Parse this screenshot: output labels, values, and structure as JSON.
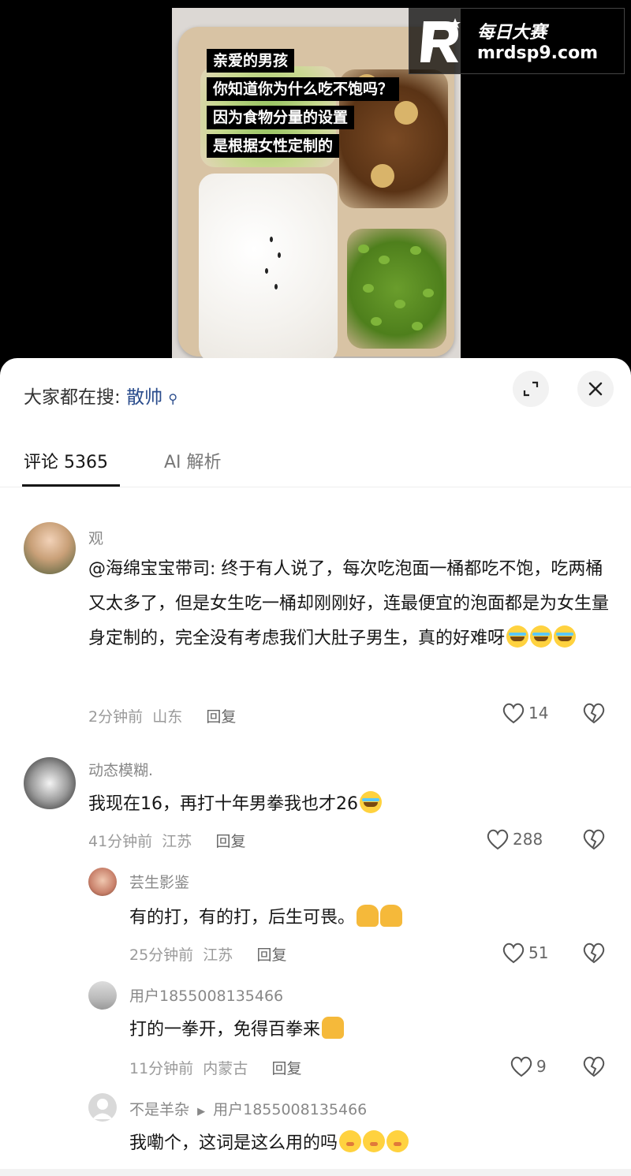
{
  "video": {
    "captions": [
      "亲爱的男孩",
      "你知道你为什么吃不饱吗？",
      "因为食物分量的设置",
      "是根据女性定制的"
    ],
    "watermark": {
      "name": "每日大赛",
      "url": "mrdsp9.com"
    }
  },
  "search": {
    "prefix": "大家都在搜:",
    "term": "散帅"
  },
  "tabs": [
    {
      "label": "评论 5365"
    },
    {
      "label": "AI 解析"
    }
  ],
  "comments": [
    {
      "user": "观",
      "text": "@海绵宝宝带司: 终于有人说了，每次吃泡面一桶都吃不饱，吃两桶又太多了，但是女生吃一桶却刚刚好，连最便宜的泡面都是为女生量身定制的，完全没有考虑我们大肚子男生，真的好难呀",
      "time": "2分钟前",
      "location": "山东",
      "reply": "回复",
      "likes": "14"
    },
    {
      "user": "动态模糊.",
      "text": "我现在16，再打十年男拳我也才26",
      "time": "41分钟前",
      "location": "江苏",
      "reply": "回复",
      "likes": "288"
    },
    {
      "user": "芸生影鉴",
      "text": "有的打，有的打，后生可畏。",
      "time": "25分钟前",
      "location": "江苏",
      "reply": "回复",
      "likes": "51"
    },
    {
      "user": "用户1855008135466",
      "text": "打的一拳开，免得百拳来",
      "time": "11分钟前",
      "location": "内蒙古",
      "reply": "回复",
      "likes": "9"
    },
    {
      "user": "不是羊杂",
      "reply_to": "用户1855008135466",
      "text": "我嘞个，这词是这么用的吗"
    }
  ],
  "icons": {
    "expand": "expand-icon",
    "close": "close-icon",
    "heart": "heart-icon",
    "dislike": "broken-heart-icon",
    "search": "search-icon"
  }
}
